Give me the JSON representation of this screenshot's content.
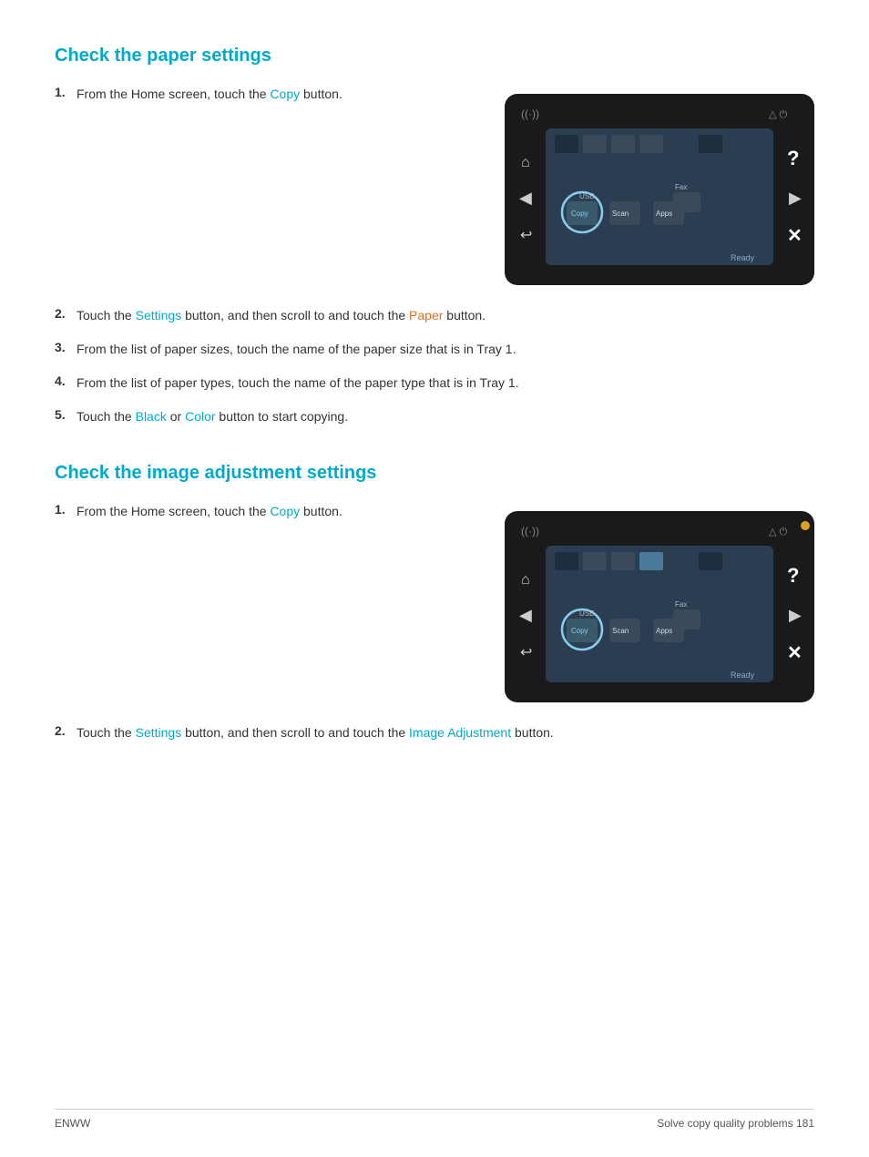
{
  "page": {
    "footer_left": "ENWW",
    "footer_right": "Solve copy quality problems     181"
  },
  "section1": {
    "heading": "Check the paper settings",
    "step1": {
      "number": "1.",
      "text_before": "From the Home screen, touch the ",
      "link": "Copy",
      "text_after": " button."
    },
    "step2": {
      "number": "2.",
      "text_before": "Touch the ",
      "link1": "Settings",
      "text_mid": " button, and then scroll to and touch the ",
      "link2": "Paper",
      "text_after": " button."
    },
    "step3": {
      "number": "3.",
      "text": "From the list of paper sizes, touch the name of the paper size that is in Tray 1."
    },
    "step4": {
      "number": "4.",
      "text": "From the list of paper types, touch the name of the paper type that is in Tray 1."
    },
    "step5": {
      "number": "5.",
      "text_before": "Touch the ",
      "link1": "Black",
      "text_mid": " or ",
      "link2": "Color",
      "text_after": " button to start copying."
    }
  },
  "section2": {
    "heading": "Check the image adjustment settings",
    "step1": {
      "number": "1.",
      "text_before": "From the Home screen, touch the ",
      "link": "Copy",
      "text_after": " button."
    },
    "step2": {
      "number": "2.",
      "text_before": "Touch the ",
      "link1": "Settings",
      "text_mid": " button, and then scroll to and touch the ",
      "link2": "Image Adjustment",
      "text_after": " button."
    }
  },
  "screen1": {
    "ready_text": "Ready",
    "usb": "USB",
    "fax": "Fax",
    "copy": "Copy",
    "scan": "Scan",
    "apps": "Apps"
  },
  "screen2": {
    "ready_text": "Ready",
    "usb": "USB",
    "fax": "Fax",
    "copy": "Copy",
    "scan": "Scan",
    "apps": "Apps"
  }
}
